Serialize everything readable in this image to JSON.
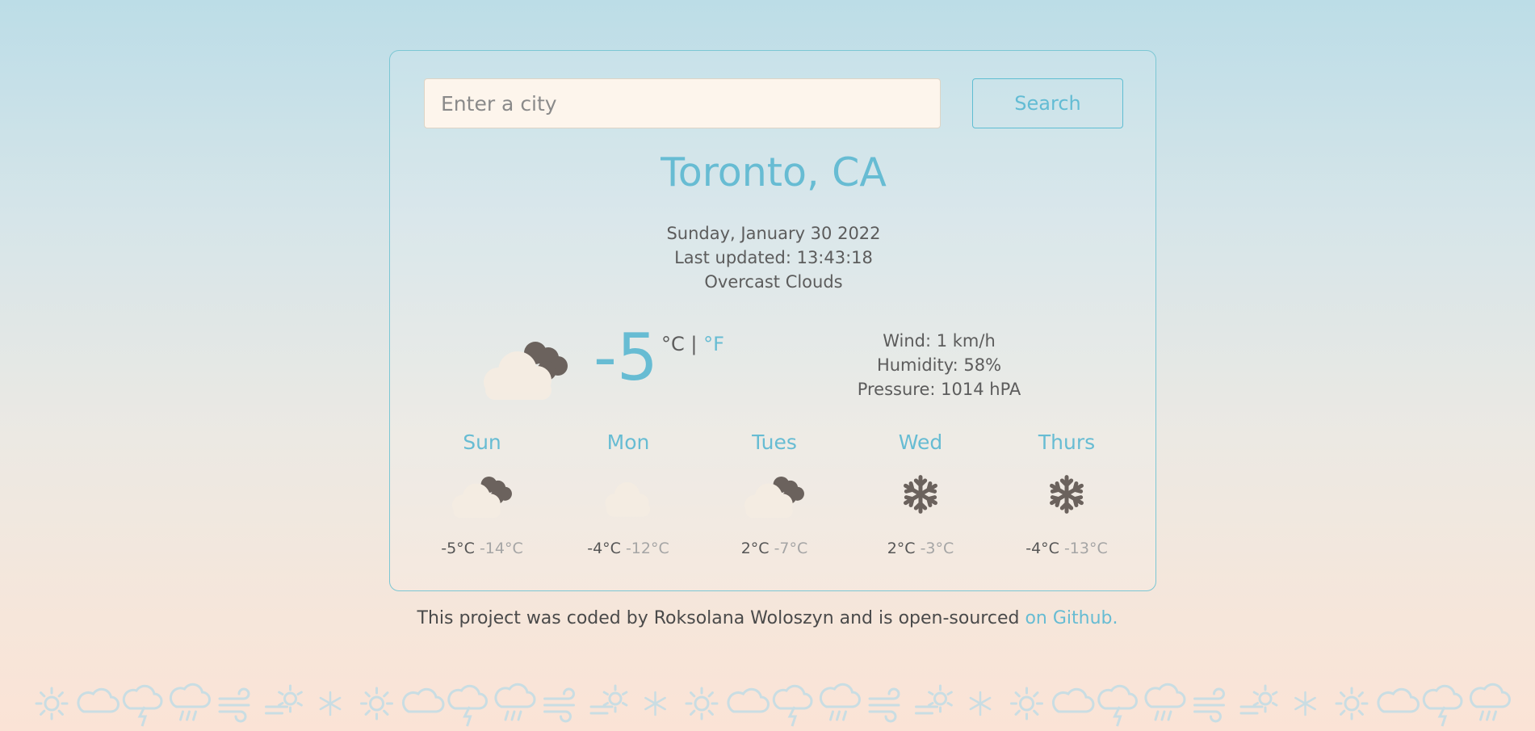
{
  "search": {
    "placeholder": "Enter a city",
    "button_label": "Search"
  },
  "current": {
    "city": "Toronto, CA",
    "date": "Sunday, January 30 2022",
    "last_updated": "Last updated: 13:43:18",
    "description": "Overcast Clouds",
    "temperature": "-5",
    "unit_celsius": "°C",
    "unit_separator": " | ",
    "unit_fahrenheit": "°F",
    "icon": "cloud-with-dark-cloud-icon",
    "wind": "Wind: 1 km/h",
    "humidity": "Humidity: 58%",
    "pressure": "Pressure: 1014 hPA"
  },
  "forecast": [
    {
      "day": "Sun",
      "max": "-5°C",
      "min": "-14°C",
      "icon": "cloud-with-dark-cloud-icon"
    },
    {
      "day": "Mon",
      "max": "-4°C",
      "min": "-12°C",
      "icon": "cloud-icon"
    },
    {
      "day": "Tues",
      "max": "2°C",
      "min": "-7°C",
      "icon": "cloud-with-dark-cloud-icon"
    },
    {
      "day": "Wed",
      "max": "2°C",
      "min": "-3°C",
      "icon": "snowflake-icon"
    },
    {
      "day": "Thurs",
      "max": "-4°C",
      "min": "-13°C",
      "icon": "snowflake-icon"
    }
  ],
  "footer": {
    "text": "This project was coded by Roksolana Woloszyn and is open-sourced ",
    "link": "on Github."
  },
  "colors": {
    "accent": "#67bcd3",
    "light_cloud": "#f4ece2",
    "dark_cloud": "#6b625d",
    "strip_icon": "#c9dde3"
  },
  "decorative_strip_icons": [
    "sun-icon",
    "cloud-icon",
    "storm-icon",
    "rain-icon",
    "wind-icon",
    "sun-wind-icon",
    "snowflake-icon"
  ]
}
